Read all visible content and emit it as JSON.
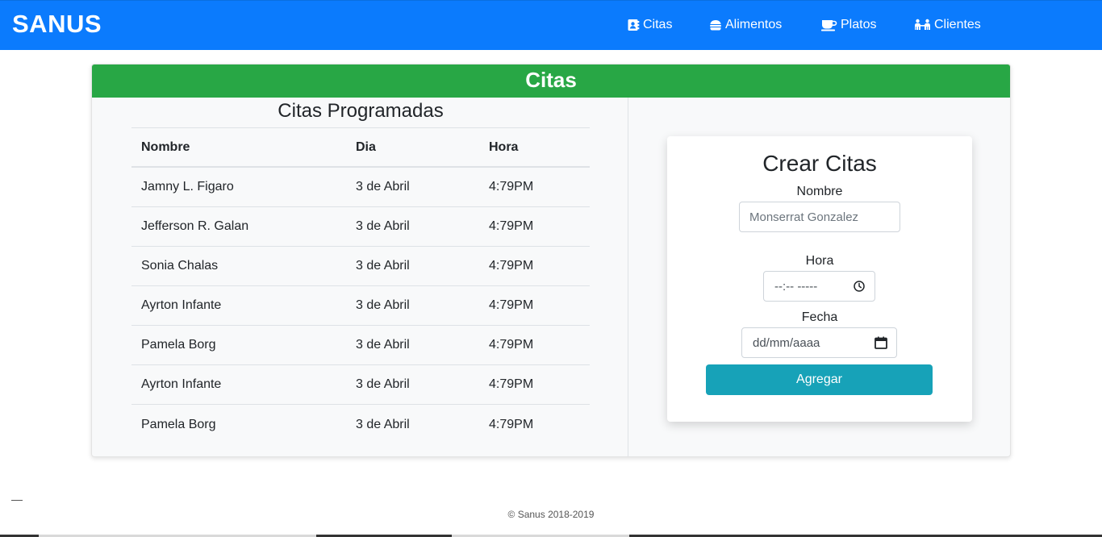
{
  "navbar": {
    "brand": "SANUS",
    "items": [
      {
        "label": "Citas",
        "icon": "address-book-icon"
      },
      {
        "label": "Alimentos",
        "icon": "hamburger-icon"
      },
      {
        "label": "Platos",
        "icon": "coffee-cup-icon"
      },
      {
        "label": "Clientes",
        "icon": "people-icon"
      }
    ],
    "color": "#0b7bfd"
  },
  "card": {
    "header": "Citas",
    "header_color": "#28a745"
  },
  "table": {
    "title": "Citas Programadas",
    "columns": [
      "Nombre",
      "Dia",
      "Hora"
    ],
    "rows": [
      [
        "Jamny L. Figaro",
        "3 de Abril",
        "4:79PM"
      ],
      [
        "Jefferson R. Galan",
        "3 de Abril",
        "4:79PM"
      ],
      [
        "Sonia Chalas",
        "3 de Abril",
        "4:79PM"
      ],
      [
        "Ayrton Infante",
        "3 de Abril",
        "4:79PM"
      ],
      [
        "Pamela Borg",
        "3 de Abril",
        "4:79PM"
      ],
      [
        "Ayrton Infante",
        "3 de Abril",
        "4:79PM"
      ],
      [
        "Pamela Borg",
        "3 de Abril",
        "4:79PM"
      ]
    ]
  },
  "form": {
    "title": "Crear Citas",
    "nombre_label": "Nombre",
    "nombre_placeholder": "Monserrat Gonzalez",
    "hora_label": "Hora",
    "hora_placeholder": "--:-- -----",
    "fecha_label": "Fecha",
    "fecha_placeholder": "dd/mm/aaaa",
    "submit_label": "Agregar",
    "button_color": "#17a2b8"
  },
  "footer": {
    "text": "© Sanus 2018-2019"
  }
}
